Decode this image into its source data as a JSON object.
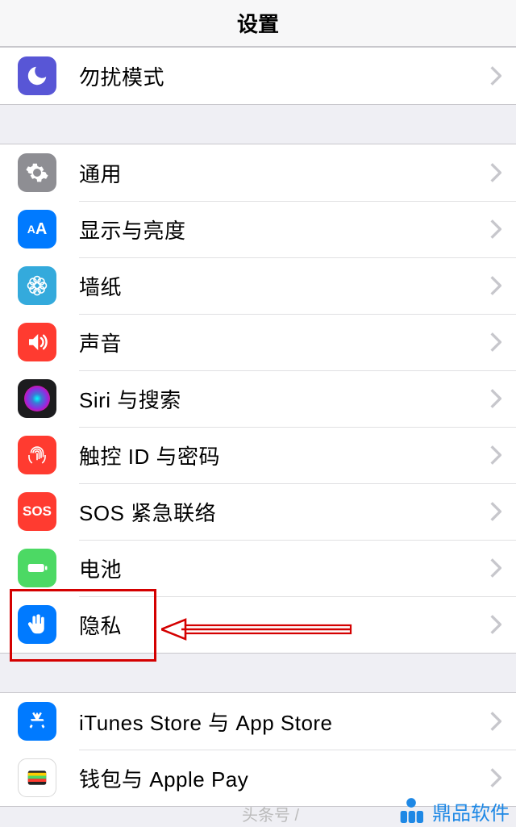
{
  "header": {
    "title": "设置"
  },
  "groups": [
    {
      "items": [
        {
          "key": "dnd",
          "label": "勿扰模式"
        }
      ]
    },
    {
      "items": [
        {
          "key": "general",
          "label": "通用"
        },
        {
          "key": "display",
          "label": "显示与亮度"
        },
        {
          "key": "wallpaper",
          "label": "墙纸"
        },
        {
          "key": "sound",
          "label": "声音"
        },
        {
          "key": "siri",
          "label": "Siri 与搜索"
        },
        {
          "key": "touchid",
          "label": "触控 ID 与密码"
        },
        {
          "key": "sos",
          "label": "SOS 紧急联络"
        },
        {
          "key": "battery",
          "label": "电池"
        },
        {
          "key": "privacy",
          "label": "隐私"
        }
      ]
    },
    {
      "items": [
        {
          "key": "appstore",
          "label": "iTunes Store 与 App Store"
        },
        {
          "key": "wallet",
          "label": "钱包与 Apple Pay"
        }
      ]
    }
  ],
  "icon_text": {
    "display": "AA",
    "sos": "SOS"
  },
  "watermark": {
    "toutiao": "头条号 /",
    "brand": "鼎品软件"
  },
  "annotation": {
    "target": "privacy"
  }
}
